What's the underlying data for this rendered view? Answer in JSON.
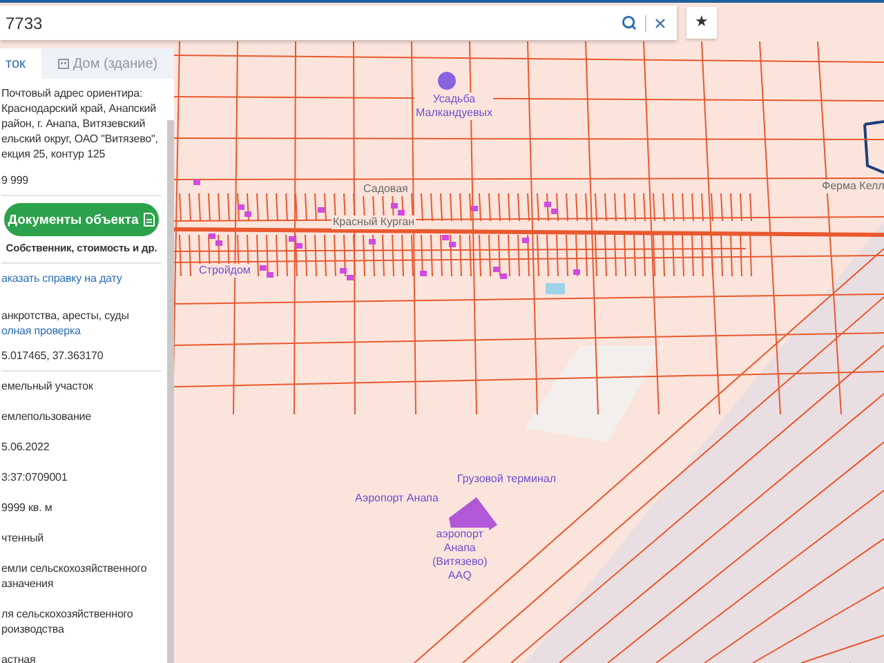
{
  "search": {
    "value": "7733"
  },
  "favorite_button": {
    "label": "★"
  },
  "panel": {
    "tabs": [
      {
        "label": "ток",
        "selected": true,
        "disabled": false
      },
      {
        "label": "Дом (здание)",
        "selected": false,
        "disabled": true
      }
    ],
    "address_lines": [
      "Почтовый адрес ориентира:",
      "Краснодарский край, Анапский",
      "район, г. Анапа, Витязевский",
      "ельский округ, ОАО \"Витязево\",",
      "екция 25, контур 125"
    ],
    "area_value": "9 999",
    "documents_button": {
      "label": "Документы объекта"
    },
    "documents_caption": "Собственник, стоимость и др.",
    "order_link": "аказать справку на дату",
    "checks_text": "анкротства, аресты, суды",
    "full_check_link": "олная проверка",
    "coordinates": "5.017465, 37.363170",
    "fields": [
      {
        "lines": [
          "емельный участок"
        ]
      },
      {
        "lines": [
          "емлепользование"
        ]
      },
      {
        "lines": [
          "5.06.2022"
        ]
      },
      {
        "lines": [
          "3:37:0709001"
        ]
      },
      {
        "lines": [
          "9999 кв. м"
        ]
      },
      {
        "lines": [
          "чтенный"
        ]
      },
      {
        "lines": [
          "емли сельскохозяйственного",
          "азначения"
        ]
      },
      {
        "lines": [
          "ля сельскохозяйственного",
          "роизводства"
        ]
      },
      {
        "lines": [
          "астная"
        ]
      }
    ]
  },
  "map": {
    "labels": [
      {
        "lines": [
          "Усадьба",
          "Малкандуевых"
        ],
        "kind": "poi"
      },
      {
        "lines": [
          "Садовая"
        ],
        "kind": "street"
      },
      {
        "lines": [
          "Красный Курган"
        ],
        "kind": "street"
      },
      {
        "lines": [
          "Стройдом"
        ],
        "kind": "poi"
      },
      {
        "lines": [
          "Ферма Келл"
        ],
        "kind": "street"
      },
      {
        "lines": [
          "Грузовой терминал"
        ],
        "kind": "poi"
      },
      {
        "lines": [
          "Аэропорт Анапа"
        ],
        "kind": "poi"
      },
      {
        "lines": [
          "аэропорт",
          "Анапа",
          "(Витязево)",
          "AAQ"
        ],
        "kind": "poi"
      }
    ]
  }
}
